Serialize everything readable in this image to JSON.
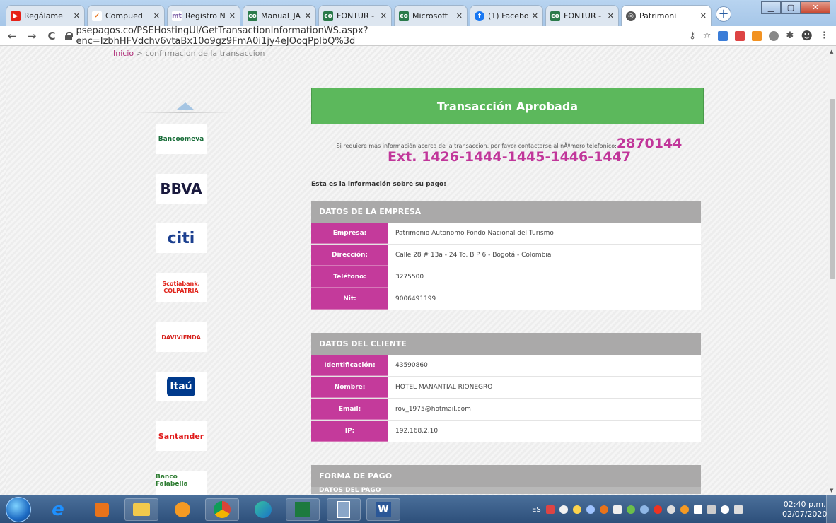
{
  "browser": {
    "tabs": [
      {
        "label": "Regálame",
        "icon": "youtube-icon",
        "color": "#e62117"
      },
      {
        "label": "Compued",
        "icon": "check-icon",
        "color": "#e8731a"
      },
      {
        "label": "Registro N",
        "icon": "mt-icon",
        "color": "#7b5ea7"
      },
      {
        "label": "Manual_JA",
        "icon": "co-icon",
        "color": "#2a7a4a"
      },
      {
        "label": "FONTUR -",
        "icon": "co-icon",
        "color": "#2a7a4a"
      },
      {
        "label": "Microsoft",
        "icon": "co-icon",
        "color": "#2a7a4a"
      },
      {
        "label": "(1) Facebo",
        "icon": "facebook-icon",
        "color": "#1877f2"
      },
      {
        "label": "FONTUR -",
        "icon": "co-icon",
        "color": "#2a7a4a"
      },
      {
        "label": "Patrimoni",
        "icon": "globe-icon",
        "color": "#555555"
      }
    ],
    "new_tab": "+",
    "url": "psepagos.co/PSEHostingUI/GetTransactionInformationWS.aspx?enc=IzbhHFVdchv6vtaBx10o9gz9FmA0i1jy4eJOoqPplbQ%3d",
    "back": "←",
    "forward": "→",
    "reload": "C"
  },
  "breadcrumb": {
    "home": "Inicio",
    "separator": ">",
    "current": "confirmacion de la transaccion"
  },
  "banks": [
    {
      "name": "Bancoomeva",
      "color": "#1a6e3a"
    },
    {
      "name": "BBVA",
      "color": "#1a1a3e"
    },
    {
      "name": "citi",
      "color": "#1b3f8f"
    },
    {
      "name": "Scotiabank. COLPATRIA",
      "color": "#e0241b"
    },
    {
      "name": "DAVIVIENDA",
      "color": "#d6231e"
    },
    {
      "name": "Itaú",
      "color": "#ffffff"
    },
    {
      "name": "Santander",
      "color": "#e01a1a"
    },
    {
      "name": "Banco Falabella",
      "color": "#2e7d32"
    }
  ],
  "status": {
    "title": "Transacción Aprobada",
    "color": "#5cb85c"
  },
  "info": {
    "text": "Si requiere más información acerca de la transaccion, por favor contactarse al nÃºmero telefonico:",
    "phone": "2870144",
    "ext": "Ext. 1426-1444-1445-1446-1447"
  },
  "pay_header": "Esta es la información sobre su pago:",
  "empresa": {
    "title": "DATOS DE LA EMPRESA",
    "rows": [
      {
        "label": "Empresa:",
        "value": "Patrimonio Autonomo Fondo Nacional del Turismo"
      },
      {
        "label": "Dirección:",
        "value": "Calle 28 # 13a - 24 To. B P 6 - Bogotá - Colombia"
      },
      {
        "label": "Teléfono:",
        "value": "3275500"
      },
      {
        "label": "Nit:",
        "value": "9006491199"
      }
    ]
  },
  "cliente": {
    "title": "DATOS DEL CLIENTE",
    "rows": [
      {
        "label": "Identificación:",
        "value": "43590860"
      },
      {
        "label": "Nombre:",
        "value": "HOTEL MANANTIAL RIONEGRO"
      },
      {
        "label": "Email:",
        "value": "rov_1975@hotmail.com"
      },
      {
        "label": "IP:",
        "value": "192.168.2.10"
      }
    ]
  },
  "forma_pago": {
    "title": "FORMA DE PAGO",
    "sub": "DATOS DEL PAGO"
  },
  "taskbar": {
    "language": "ES",
    "time": "02:40 p.m.",
    "date": "02/07/2020"
  },
  "colors": {
    "accent": "#c43a9b",
    "header_gray": "#aaa9a9"
  }
}
